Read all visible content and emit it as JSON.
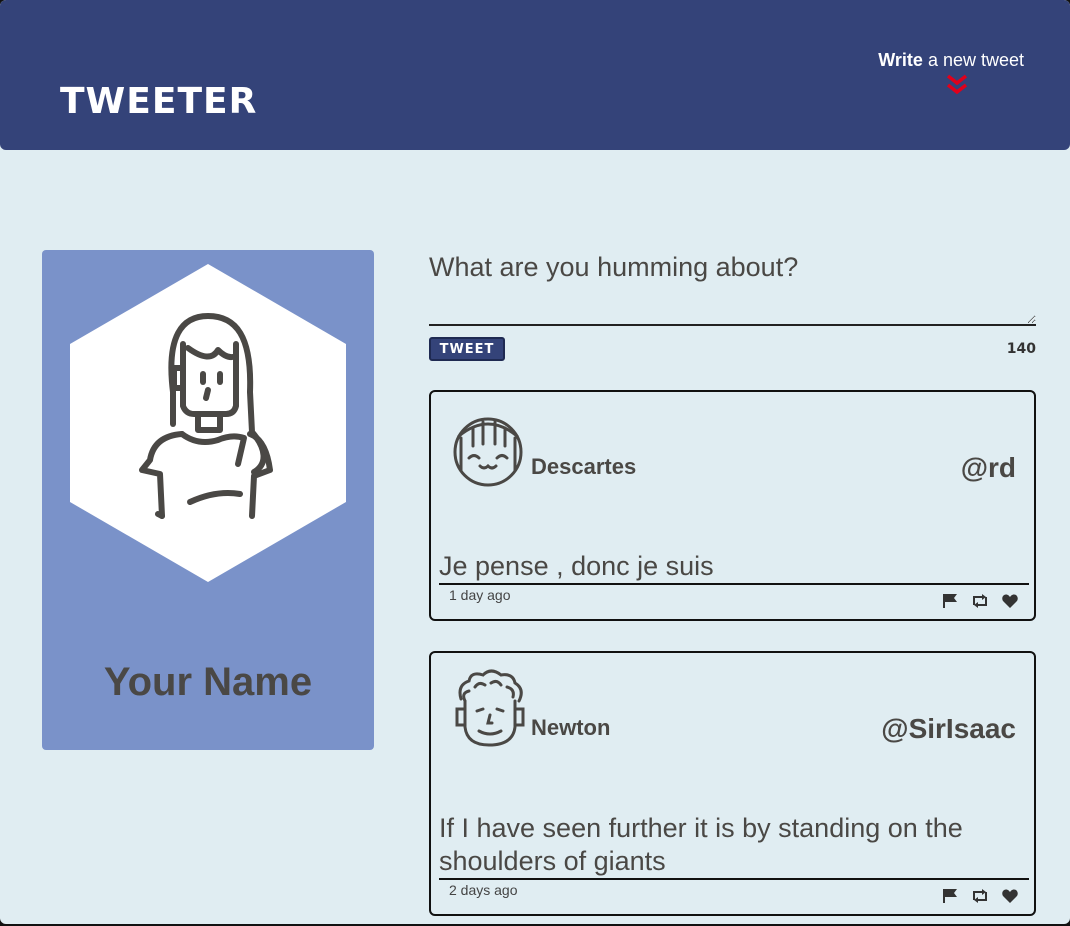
{
  "header": {
    "brand": "TWEETER",
    "write_bold": "Write",
    "write_rest": " a new tweet"
  },
  "profile": {
    "name": "Your Name"
  },
  "compose": {
    "placeholder": "What are you humming about?",
    "button_label": "TWEET",
    "counter": "140"
  },
  "tweets": [
    {
      "name": "Descartes",
      "handle": "@rd",
      "content": "Je pense , donc je suis",
      "date": "1 day ago"
    },
    {
      "name": "Newton",
      "handle": "@SirIsaac",
      "content": "If I have seen further it is by standing on the shoulders of giants",
      "date": "2 days ago"
    }
  ],
  "colors": {
    "navbar": "#344379",
    "background": "#e0edf2",
    "profile_card": "#7a92c9",
    "accent_arrow": "#e0001b"
  }
}
